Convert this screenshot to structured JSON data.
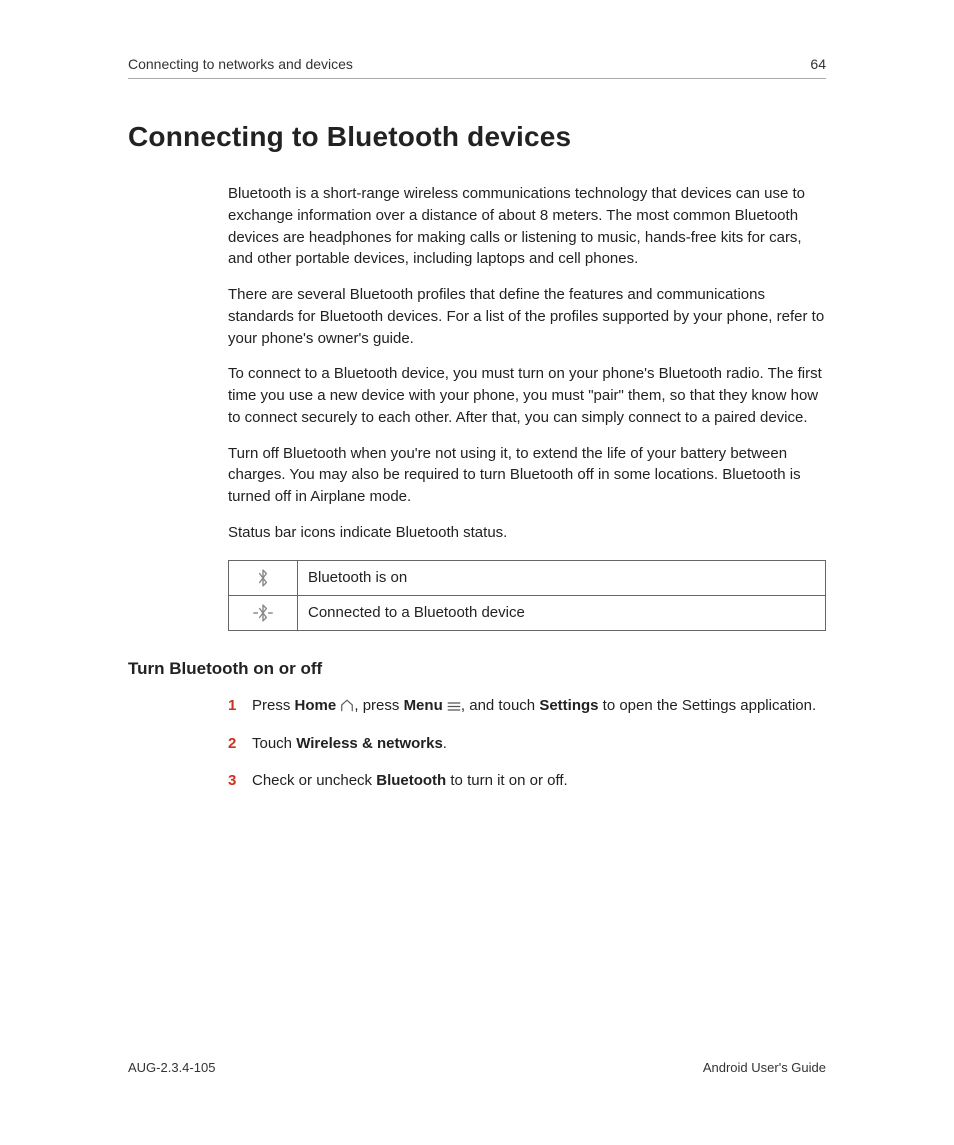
{
  "header": {
    "section": "Connecting to networks and devices",
    "page_number": "64"
  },
  "title": "Connecting to Bluetooth devices",
  "paragraphs": {
    "p1": "Bluetooth is a short-range wireless communications technology that devices can use to exchange information over a distance of about 8 meters. The most common Bluetooth devices are headphones for making calls or listening to music, hands-free kits for cars, and other portable devices, including laptops and cell phones.",
    "p2": "There are several Bluetooth profiles that define the features and communications standards for Bluetooth devices. For a list of the profiles supported by your phone, refer to your phone's owner's guide.",
    "p3": "To connect to a Bluetooth device, you must turn on your phone's Bluetooth radio. The first time you use a new device with your phone, you must \"pair\" them, so that they know how to connect securely to each other. After that, you can simply connect to a paired device.",
    "p4": "Turn off Bluetooth when you're not using it, to extend the life of your battery between charges. You may also be required to turn Bluetooth off in some locations. Bluetooth is turned off in Airplane mode.",
    "p5": "Status bar icons indicate Bluetooth status."
  },
  "icon_table": {
    "row1": {
      "icon": "bluetooth-icon",
      "label": "Bluetooth is on"
    },
    "row2": {
      "icon": "bluetooth-connected-icon",
      "label": "Connected to a Bluetooth device"
    }
  },
  "subhead": "Turn Bluetooth on or off",
  "steps": {
    "s1": {
      "num": "1",
      "pre": "Press ",
      "b1": "Home",
      "mid1": " ",
      "mid2": ", press ",
      "b2": "Menu",
      "mid3": " ",
      "mid4": ", and touch ",
      "b3": "Settings",
      "post": " to open the Settings application."
    },
    "s2": {
      "num": "2",
      "pre": "Touch ",
      "b1": "Wireless & networks",
      "post": "."
    },
    "s3": {
      "num": "3",
      "pre": "Check or uncheck ",
      "b1": "Bluetooth",
      "post": " to turn it on or off."
    }
  },
  "footer": {
    "left": "AUG-2.3.4-105",
    "right": "Android User's Guide"
  }
}
